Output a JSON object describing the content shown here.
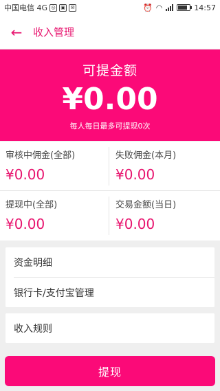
{
  "statusbar": {
    "carrier": "中国电信 4G",
    "time": "14:57",
    "network": "4G"
  },
  "appbar": {
    "back_icon": "←",
    "title": "收入管理"
  },
  "hero": {
    "label": "可提金额",
    "amount": "¥0.00",
    "note": "每人每日最多可提现0次"
  },
  "stats": [
    {
      "label": "审核中佣金(全部)",
      "value": "¥0.00"
    },
    {
      "label": "失败佣金(本月)",
      "value": "¥0.00"
    },
    {
      "label": "提现中(全部)",
      "value": "¥0.00"
    },
    {
      "label": "交易金额(当日)",
      "value": "¥0.00"
    }
  ],
  "menu": {
    "items": [
      "资金明细",
      "银行卡/支付宝管理"
    ],
    "rules": "收入规则"
  },
  "withdraw_button": "提现",
  "colors": {
    "accent": "#fb0a78",
    "text_accent": "#e8156f"
  }
}
